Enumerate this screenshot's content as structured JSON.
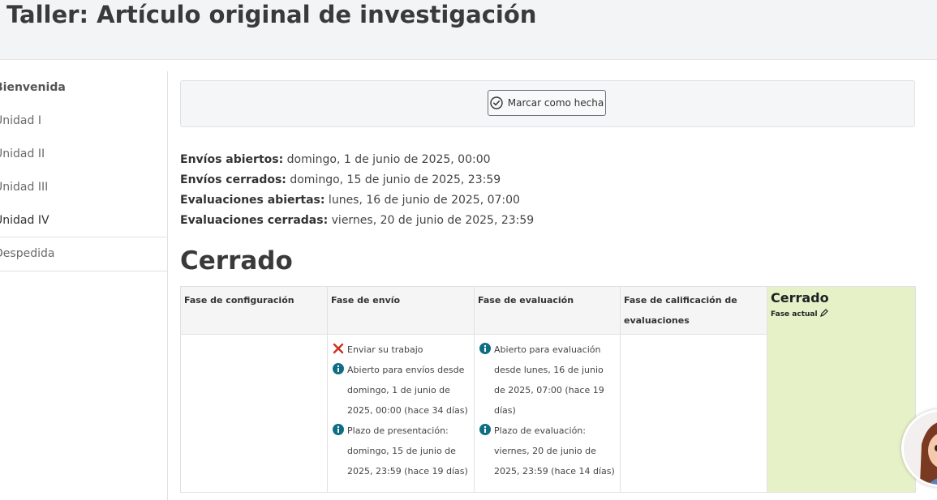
{
  "page": {
    "title": "Taller: Artículo original de investigación"
  },
  "sidebar": {
    "items": [
      {
        "label": "Bienvenida"
      },
      {
        "label": "Unidad I"
      },
      {
        "label": "Unidad II"
      },
      {
        "label": "Unidad III"
      },
      {
        "label": "Unidad IV"
      },
      {
        "label": "Despedida"
      }
    ]
  },
  "completion": {
    "button_label": "Marcar como hecha"
  },
  "dates": [
    {
      "label": "Envíos abiertos:",
      "value": " domingo, 1 de junio de 2025, 00:00"
    },
    {
      "label": "Envíos cerrados:",
      "value": " domingo, 15 de junio de 2025, 23:59"
    },
    {
      "label": "Evaluaciones abiertas:",
      "value": " lunes, 16 de junio de 2025, 07:00"
    },
    {
      "label": "Evaluaciones cerradas:",
      "value": " viernes, 20 de junio de 2025, 23:59"
    }
  ],
  "status": {
    "heading": "Cerrado"
  },
  "phases": [
    {
      "title": "Fase de configuración",
      "tasks": []
    },
    {
      "title": "Fase de envío",
      "tasks": [
        {
          "icon": "fail-x-icon",
          "lines": [
            "Enviar su trabajo"
          ]
        },
        {
          "icon": "info-icon",
          "lines": [
            "Abierto para envíos desde",
            "domingo, 1 de junio de",
            "2025, 00:00 (hace 34 días)"
          ]
        },
        {
          "icon": "info-icon",
          "lines": [
            "Plazo de presentación:",
            "domingo, 15 de junio de",
            "2025, 23:59 (hace 19 días)"
          ]
        }
      ]
    },
    {
      "title": "Fase de evaluación",
      "tasks": [
        {
          "icon": "info-icon",
          "lines": [
            "Abierto para evaluación",
            "desde lunes, 16 de junio",
            "de 2025, 07:00 (hace 19",
            "días)"
          ]
        },
        {
          "icon": "info-icon",
          "lines": [
            "Plazo de evaluación:",
            "viernes, 20 de junio de",
            "2025, 23:59 (hace 14 días)"
          ]
        }
      ]
    },
    {
      "title_lines": [
        "Fase de calificación de",
        "evaluaciones"
      ],
      "tasks": []
    },
    {
      "title": "Cerrado",
      "current_label": "Fase actual",
      "tasks": []
    }
  ],
  "colors": {
    "info": "#0f6e84",
    "fail": "#ca3120",
    "current_phase_bg": "#e7f1c8"
  }
}
